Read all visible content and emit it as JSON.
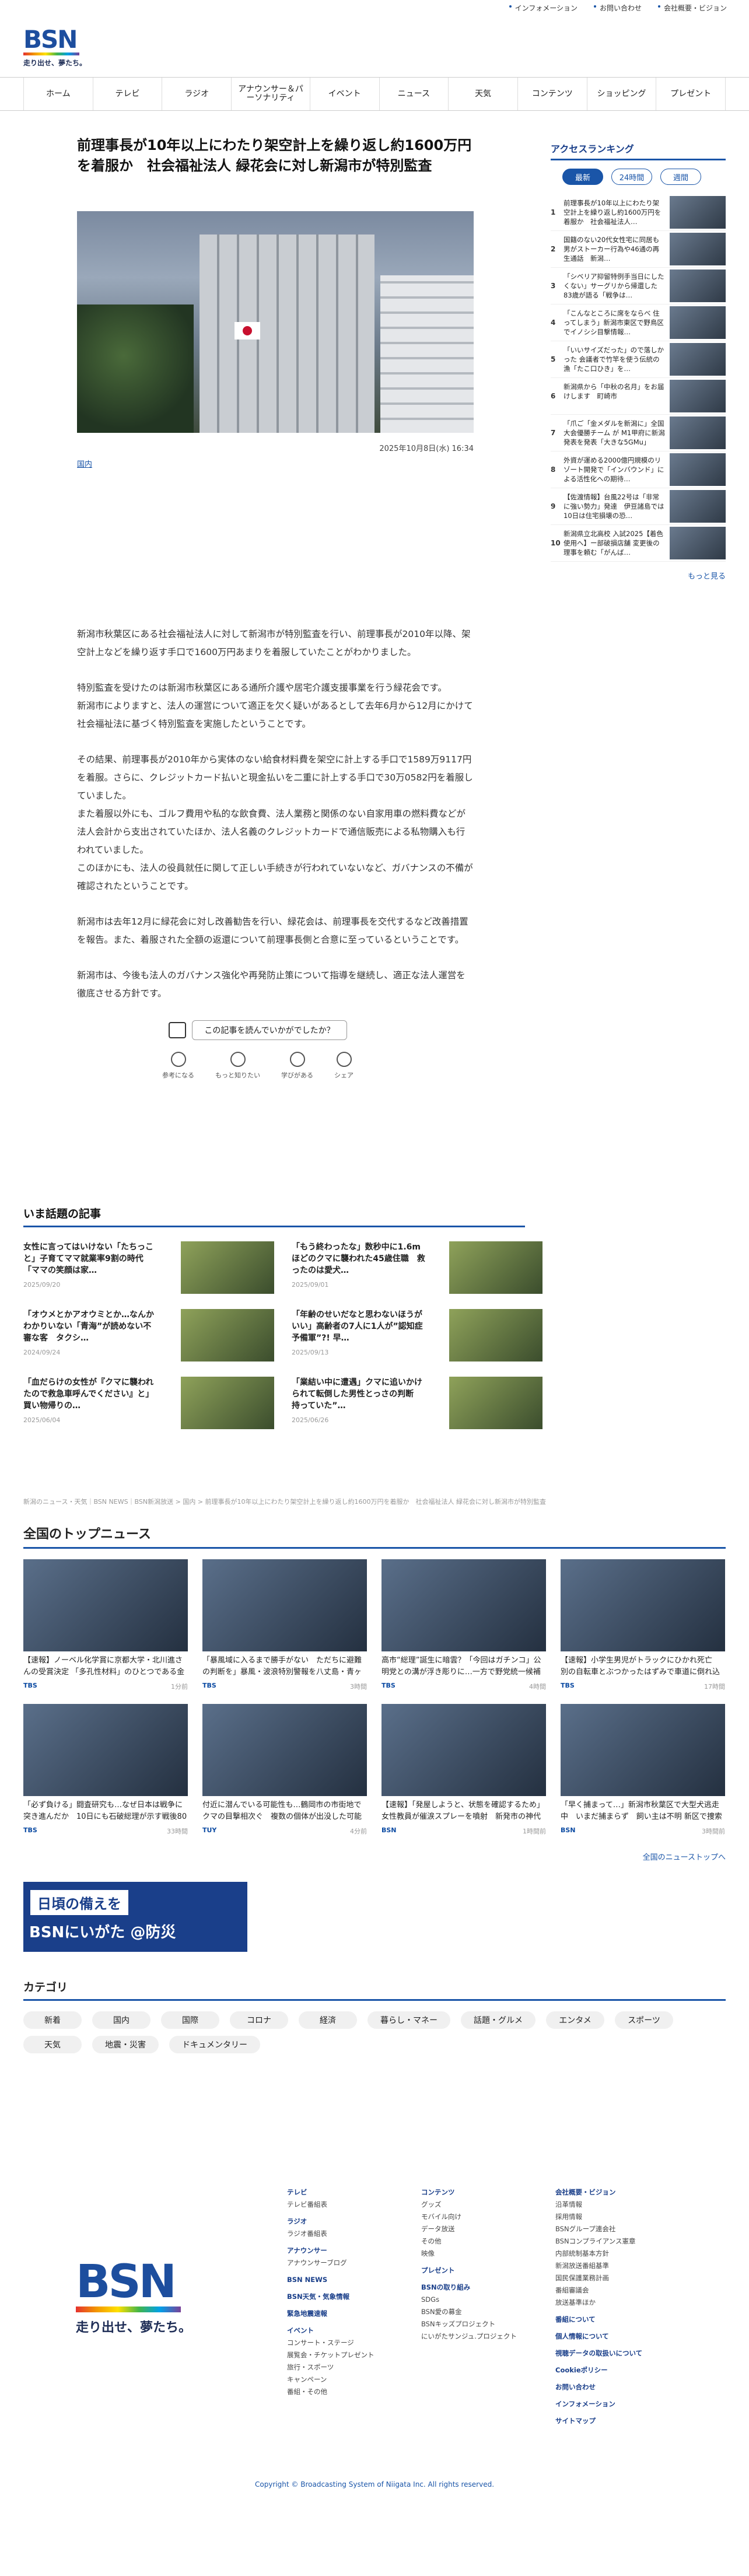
{
  "topbar": [
    "インフォメーション",
    "お問い合わせ",
    "会社概要・ビジョン"
  ],
  "logo": {
    "mark": "BSN",
    "tagline": "走り出せ、夢たち。"
  },
  "nav": [
    "ホーム",
    "テレビ",
    "ラジオ",
    "アナウンサー＆パーソナリティ",
    "イベント",
    "ニュース",
    "天気",
    "コンテンツ",
    "ショッピング",
    "プレゼント"
  ],
  "article": {
    "title": "前理事長が10年以上にわたり架空計上を繰り返し約1600万円を着服か　社会福祉法人 緑花会に対し新潟市が特別監査",
    "date": "2025年10月8日(水) 16:34",
    "category": "国内",
    "paragraphs": [
      "新潟市秋葉区にある社会福祉法人に対して新潟市が特別監査を行い、前理事長が2010年以降、架空計上などを繰り返す手口で1600万円あまりを着服していたことがわかりました。",
      "特別監査を受けたのは新潟市秋葉区にある通所介護や居宅介護支援事業を行う緑花会です。\n新潟市によりますと、法人の運営について適正を欠く疑いがあるとして去年6月から12月にかけて社会福祉法に基づく特別監査を実施したということです。",
      "その結果、前理事長が2010年から実体のない給食材料費を架空に計上する手口で1589万9117円を着服。さらに、クレジットカード払いと現金払いを二重に計上する手口で30万0582円を着服していました。\nまた着服以外にも、ゴルフ費用や私的な飲食費、法人業務と関係のない自家用車の燃料費などが法人会計から支出されていたほか、法人名義のクレジットカードで通信販売による私物購入も行われていました。\nこのほかにも、法人の役員就任に関して正しい手続きが行われていないなど、ガバナンスの不備が確認されたということです。",
      "新潟市は去年12月に緑花会に対し改善勧告を行い、緑花会は、前理事長を交代するなど改善措置を報告。また、着服された全額の返還について前理事長側と合意に至っているということです。",
      "新潟市は、今後も法人のガバナンス強化や再発防止策について指導を継続し、適正な法人運営を徹底させる方針です。"
    ],
    "feedback": {
      "question": "この記事を読んでいかがでしたか？",
      "options": [
        "参考になる",
        "もっと知りたい",
        "学びがある",
        "シェア"
      ]
    }
  },
  "ranking": {
    "title": "アクセスランキング",
    "tabs": [
      "最新",
      "24時間",
      "週間"
    ],
    "items": [
      {
        "rank": "1",
        "text": "前理事長が10年以上にわたり架空計上を繰り返し約1600万円を着服か　社会福祉法人…"
      },
      {
        "rank": "2",
        "text": "国籍のない20代女性宅に同居も 男がストーカー行為や46通の再生通話　新潟…"
      },
      {
        "rank": "3",
        "text": "「シベリア抑留特例手当日にしたくない」サーグリから帰還した83歳が語る「戦争は…"
      },
      {
        "rank": "4",
        "text": "「こんなところに席をならべ 住ってしまう」新潟市東区で野鳥区でイノシシ目撃情報…"
      },
      {
        "rank": "5",
        "text": "「いいサイズだった」ので落しかった 会議者で竹竿を使う伝統の漁「たこ口ひき」を…"
      },
      {
        "rank": "6",
        "text": "新潟県から「中秋の名月」をお届けします　町崎市"
      },
      {
        "rank": "7",
        "text": "「爪ご「金メダルを新潟に」全国大会優勝チーム が M1甲府に新潟発表を発表「大きな5GMu」"
      },
      {
        "rank": "8",
        "text": "外資が運める2000億円規模のリゾート開発で「インバウンド」による活性化への期待…"
      },
      {
        "rank": "9",
        "text": "【佐渡情報】台風22号は「非常に強い勢力」発達　伊豆諸島では10日は住宅損壊の恐…"
      },
      {
        "rank": "10",
        "text": "新潟県立北高校 入試2025【着色使用へ】ー部破損店舗 変更後の理事を頼む「がんば…"
      }
    ],
    "more": "もっと見る"
  },
  "wadai": {
    "title": "いま話題の記事",
    "items": [
      {
        "title": "女性に言ってはいけない「たちっこと」子育てママ就業率9割の時代「ママの笑顔は家…",
        "date": "2025/09/20"
      },
      {
        "title": "「もう終わったな」数秒中に1.6mほどのクマに襲われた45歳住職　救ったのは愛犬…",
        "date": "2025/09/01"
      },
      {
        "title": "「オウメとかアオウミとか…なんかわかりいない「青海”が読めない不審な客　タクシ…",
        "date": "2024/09/24"
      },
      {
        "title": "「年齢のせいだなと思わないほうがいい」高齢者の7人に1人が”認知症予備軍”?! 早…",
        "date": "2025/09/13"
      },
      {
        "title": "「血だらけの女性が『クマに襲われたので救急車呼んでください』と」買い物帰りの…",
        "date": "2025/06/04"
      },
      {
        "title": "「業結い中に遭遇」クマに追いかけられて転倒した男性とっさの判断　持っていた”…",
        "date": "2025/06/26"
      }
    ]
  },
  "breadcrumb": "新潟のニュース・天気｜BSN NEWS｜BSN新潟放送 > 国内 > 前理事長が10年以上にわたり架空計上を繰り返し約1600万円を着服か　社会福祉法人 緑花会に対し新潟市が特別監査",
  "national": {
    "title": "全国のトップニュース",
    "items": [
      {
        "title": "【速報】ノーベル化学賞に京都大学・北川進さんの受賞決定 「多孔性材料」のひとつである金属と有機物の複合…",
        "source": "TBS",
        "time": "1分前"
      },
      {
        "title": "「暴風域に入るまで勝手がない　ただちに避難の判断を」暴風・波浪特別警報を八丈島・青ヶ島に発表　大島特…",
        "source": "TBS",
        "time": "3時間"
      },
      {
        "title": "高市“総理”誕生に暗雲？「今回はガチンコ」公明党との溝が浮き彫りに…一方で野党統一候補の検討も　総理指…",
        "source": "TBS",
        "time": "4時間"
      },
      {
        "title": "【速報】小学生男児がトラックにひかれ死亡　別の自転車とぶつかったはずみで車道に倒れ込んだか　千…",
        "source": "TBS",
        "time": "17時間"
      },
      {
        "title": "「必ず負ける」闘査研究も…なぜ日本は戦争に突き進んだか　10日にも石破総理が示す戦後80年の総理見解で検…",
        "source": "TBS",
        "time": "33時間"
      },
      {
        "title": "付近に潜んでいる可能性も…鶴岡市の市街地でクマの目撃相次ぐ　複数の個体が出没した可能性（山形）",
        "source": "TUY",
        "time": "4分前"
      },
      {
        "title": "【速報】「発屋しようと、状態を確認するため」女性教員が催涙スプレーを噴射　新発市の神代小学校で異臭騒ぎ…",
        "source": "BSN",
        "time": "1時間前"
      },
      {
        "title": "「早く捕まって…」新潟市秋葉区で大型犬逃走中　いまだ捕まらず　飼い主は不明 新区で捜索する児童も",
        "source": "BSN",
        "time": "3時間前"
      }
    ],
    "more": "全国のニューストップへ"
  },
  "banner": {
    "line1": "日頃の備えを",
    "line2": "BSNにいがた @防災"
  },
  "categories": {
    "title": "カテゴリ",
    "items": [
      "新着",
      "国内",
      "国際",
      "コロナ",
      "経済",
      "暮らし・マネー",
      "話題・グルメ",
      "エンタメ",
      "スポーツ",
      "天気",
      "地震・災害",
      "ドキュメンタリー"
    ]
  },
  "footer": {
    "col1": [
      {
        "h": "テレビ",
        "i": [
          "テレビ番組表"
        ]
      },
      {
        "h": "ラジオ",
        "i": [
          "ラジオ番組表"
        ]
      },
      {
        "h": "アナウンサー",
        "i": [
          "アナウンサーブログ"
        ]
      },
      {
        "h": "BSN NEWS",
        "i": []
      },
      {
        "h": "BSN天気・気象情報",
        "i": []
      },
      {
        "h": "緊急地震速報",
        "i": []
      },
      {
        "h": "イベント",
        "i": [
          "コンサート・ステージ",
          "展覧会・チケットプレゼント",
          "旅行・スポーツ",
          "キャンペーン",
          "番組・その他"
        ]
      }
    ],
    "col2": [
      {
        "h": "コンテンツ",
        "i": [
          "グッズ",
          "モバイル向け",
          "データ放送",
          "その他",
          "映像"
        ]
      },
      {
        "h": "プレゼント",
        "i": []
      },
      {
        "h": "BSNの取り組み",
        "i": [
          "SDGs",
          "BSN愛の募金",
          "BSNキッズプロジェクト",
          "にいがたサンジュ.プロジェクト"
        ]
      }
    ],
    "col3": [
      {
        "h": "会社概要・ビジョン",
        "i": [
          "沿革情報",
          "採用情報",
          "BSNグループ連会社",
          "BSNコンプライアンス憲章",
          "内部統制基本方針",
          "新潟放送番組基準",
          "国民保護業務計画",
          "番組審議会",
          "放送基準ほか"
        ]
      },
      {
        "h": "番組について",
        "i": []
      },
      {
        "h": "個人情報について",
        "i": []
      },
      {
        "h": "視聴データの取扱いについて",
        "i": []
      },
      {
        "h": "Cookieポリシー",
        "i": []
      },
      {
        "h": "お問い合わせ",
        "i": []
      },
      {
        "h": "インフォメーション",
        "i": []
      },
      {
        "h": "サイトマップ",
        "i": []
      }
    ],
    "copyright": "Copyright © Broadcasting System of Niigata Inc. All rights reserved."
  }
}
